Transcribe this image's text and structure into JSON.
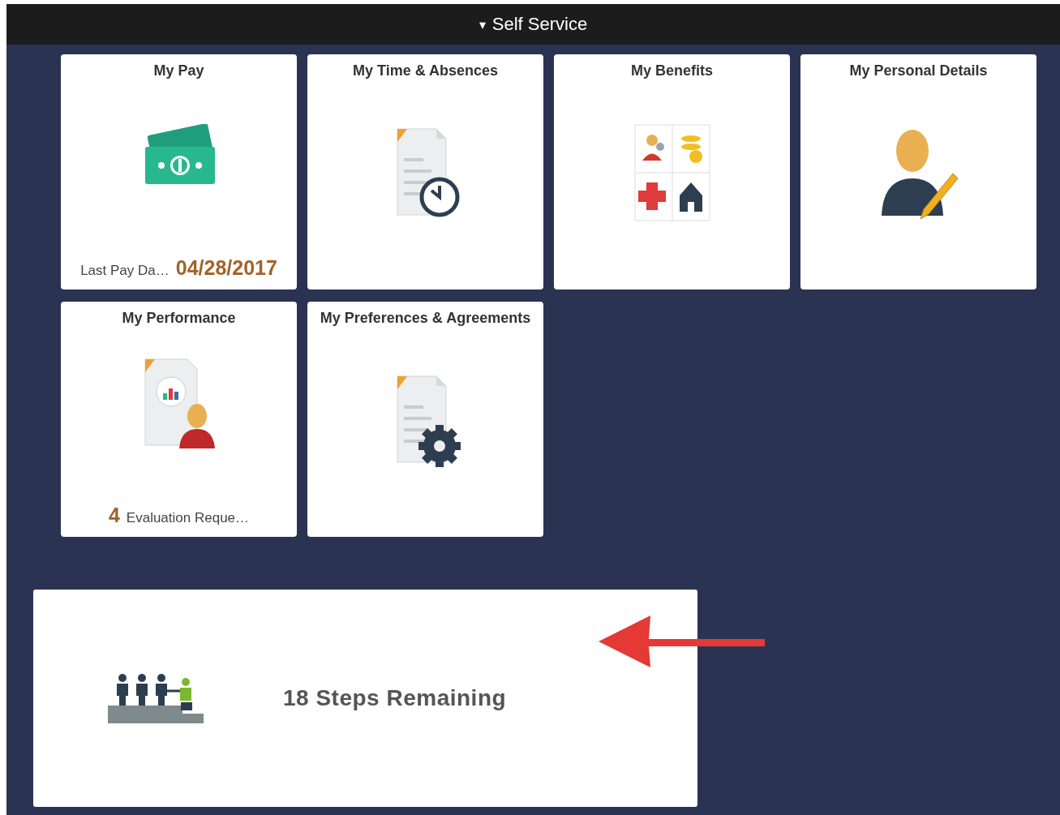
{
  "header": {
    "caret": "▾",
    "title": "Self Service"
  },
  "tiles": [
    {
      "title": "My Pay",
      "kind": "money",
      "footer": [
        {
          "kind": "label",
          "text": "Last Pay Da…"
        },
        {
          "kind": "value",
          "text": "04/28/2017"
        }
      ]
    },
    {
      "title": "My Time & Absences",
      "kind": "time"
    },
    {
      "title": "My Benefits",
      "kind": "benefits"
    },
    {
      "title": "My Personal Details",
      "kind": "person"
    },
    {
      "title": "My Performance",
      "kind": "performance",
      "footer": [
        {
          "kind": "value",
          "text": "4"
        },
        {
          "kind": "label",
          "text": "Evaluation Reque…"
        }
      ]
    },
    {
      "title": "My Preferences & Agreements",
      "kind": "preferences"
    }
  ],
  "progress": {
    "text": "18 Steps Remaining"
  }
}
